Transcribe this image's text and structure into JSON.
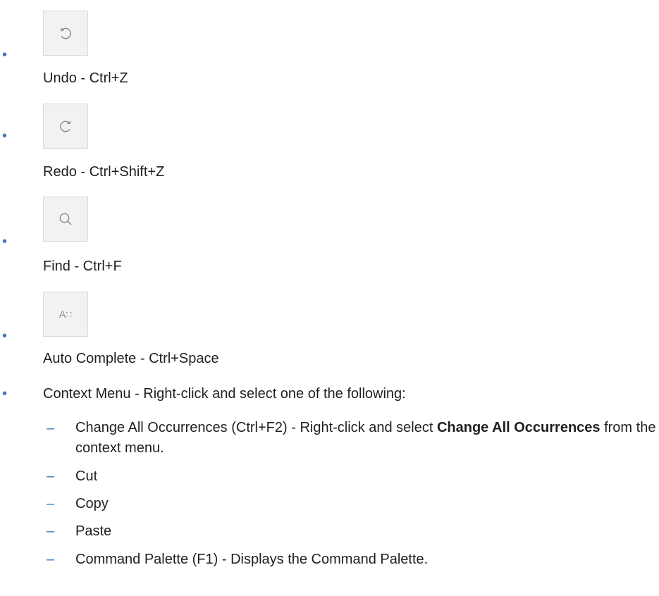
{
  "toolbar_items": [
    {
      "icon": "undo-icon",
      "caption": "Undo - Ctrl+Z"
    },
    {
      "icon": "redo-icon",
      "caption": "Redo - Ctrl+Shift+Z"
    },
    {
      "icon": "search-icon",
      "caption": "Find - Ctrl+F"
    },
    {
      "icon": "autocomplete-icon",
      "glyph": "A∷",
      "caption": "Auto Complete - Ctrl+Space"
    }
  ],
  "context_menu": {
    "intro": "Context Menu - Right-click and select one of the following:",
    "items": [
      {
        "prefix": "Change All Occurrences (Ctrl+F2) - Right-click and select ",
        "bold": "Change All Occurrences",
        "suffix": " from the context menu."
      },
      {
        "label": "Cut"
      },
      {
        "label": "Copy"
      },
      {
        "label": "Paste"
      },
      {
        "label": "Command Palette (F1) - Displays the Command Palette."
      }
    ]
  },
  "colors": {
    "bullet": "#3a78c2",
    "text": "#1f1f1f",
    "button_bg": "#f2f2f2",
    "button_border": "#d8d8d8",
    "icon": "#8a8a8a"
  }
}
